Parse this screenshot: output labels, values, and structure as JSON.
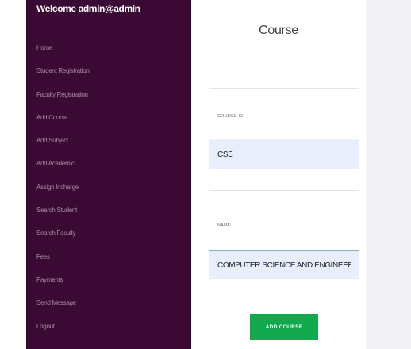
{
  "sidebar": {
    "welcome": "Welcome admin@admin",
    "items": [
      {
        "label": "Home"
      },
      {
        "label": "Student Registration"
      },
      {
        "label": "Faculty Registration"
      },
      {
        "label": "Add Course"
      },
      {
        "label": "Add Subject"
      },
      {
        "label": "Add Academic"
      },
      {
        "label": "Assign Incharge"
      },
      {
        "label": "Search Student"
      },
      {
        "label": "Search Faculty"
      },
      {
        "label": "Fees"
      },
      {
        "label": "Payments"
      },
      {
        "label": "Send Message"
      },
      {
        "label": "Logout"
      }
    ]
  },
  "main": {
    "title": "Course",
    "course_id": {
      "label": "COURSE ID",
      "value": "CSE"
    },
    "name": {
      "label": "NAME",
      "value": "COMPUTER SCIENCE AND ENGINEERING"
    },
    "submit_label": "ADD COURSE"
  },
  "colors": {
    "sidebar_bg": "#3b0a34",
    "nav_text": "#a78aa3",
    "input_bg": "#e8eefb",
    "button_green": "#12a84d"
  }
}
